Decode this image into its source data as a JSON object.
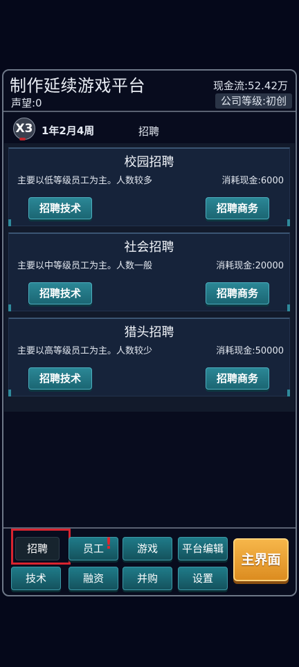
{
  "header": {
    "title": "制作延续游戏平台",
    "reputation": "声望:0",
    "cash": "现金流:52.42万",
    "company_level": "公司等级:初创"
  },
  "status": {
    "speed": "X3",
    "date": "1年2月4周",
    "page": "招聘"
  },
  "cards": [
    {
      "title": "校园招聘",
      "desc": "主要以低等级员工为主。人数较多",
      "cost": "消耗现金:6000",
      "tech_label": "招聘技术",
      "biz_label": "招聘商务"
    },
    {
      "title": "社会招聘",
      "desc": "主要以中等级员工为主。人数一般",
      "cost": "消耗现金:20000",
      "tech_label": "招聘技术",
      "biz_label": "招聘商务"
    },
    {
      "title": "猎头招聘",
      "desc": "主要以高等级员工为主。人数较少",
      "cost": "消耗现金:50000",
      "tech_label": "招聘技术",
      "biz_label": "招聘商务"
    }
  ],
  "nav": {
    "recruit": "招聘",
    "staff": "员工",
    "staff_alert": "!",
    "game": "游戏",
    "platform_edit": "平台编辑",
    "tech": "技术",
    "finance": "融资",
    "merge": "并购",
    "settings": "设置",
    "main": "主界面"
  },
  "colors": {
    "background": "#05081a",
    "teal_button": "#1f7b89",
    "main_button": "#f0a53a",
    "highlight_outline": "#d9242f"
  }
}
